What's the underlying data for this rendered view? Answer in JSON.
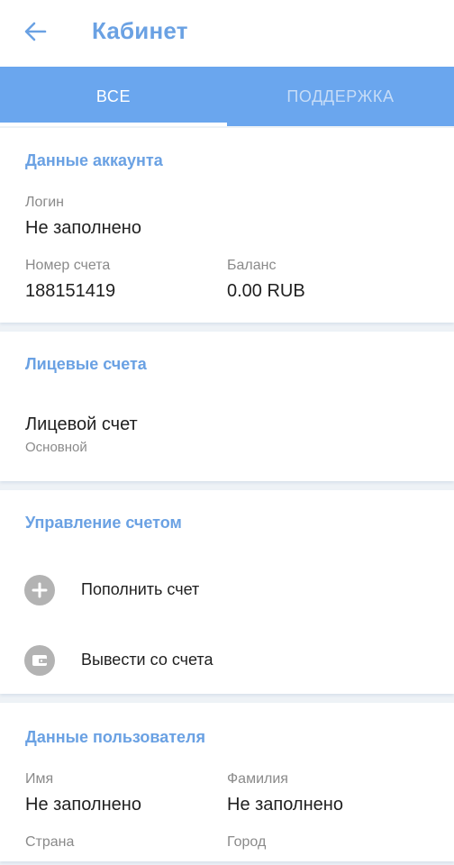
{
  "header": {
    "title": "Кабинет",
    "back_icon": "arrow-left-icon",
    "accent": "#6aa1e3"
  },
  "tabs": [
    {
      "label": "ВСЕ",
      "active": true
    },
    {
      "label": "ПОДДЕРЖКА",
      "active": false
    }
  ],
  "account": {
    "title": "Данные аккаунта",
    "login_label": "Логин",
    "login_value": "Не заполнено",
    "number_label": "Номер счета",
    "number_value": "188151419",
    "balance_label": "Баланс",
    "balance_value": "0.00 RUB"
  },
  "personal_accounts": {
    "title": "Лицевые счета",
    "item_title": "Лицевой счет",
    "item_subtitle": "Основной"
  },
  "management": {
    "title": "Управление счетом",
    "actions": [
      {
        "label": "Пополнить счет",
        "icon": "plus-circle-icon"
      },
      {
        "label": "Вывести со счета",
        "icon": "wallet-icon"
      }
    ]
  },
  "user": {
    "title": "Данные пользователя",
    "first_name_label": "Имя",
    "first_name_value": "Не заполнено",
    "last_name_label": "Фамилия",
    "last_name_value": "Не заполнено",
    "country_label": "Страна",
    "city_label": "Город"
  }
}
